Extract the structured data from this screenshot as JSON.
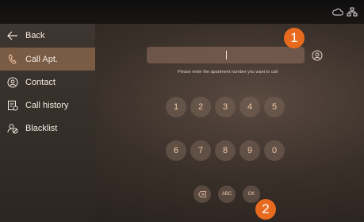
{
  "sidebar": {
    "items": [
      {
        "label": "Back",
        "icon": "arrow-left-icon"
      },
      {
        "label": "Call Apt.",
        "icon": "phone-icon"
      },
      {
        "label": "Contact",
        "icon": "contact-icon"
      },
      {
        "label": "Call history",
        "icon": "call-history-icon"
      },
      {
        "label": "Blacklist",
        "icon": "blacklist-icon"
      }
    ]
  },
  "dialer": {
    "input_value": "",
    "hint": "Please enter the apartment number you want to call",
    "keys_row1": [
      "1",
      "2",
      "3",
      "4",
      "5"
    ],
    "keys_row2": [
      "6",
      "7",
      "8",
      "9",
      "0"
    ],
    "abc_label": "ABC",
    "ok_label": "OK"
  },
  "badges": {
    "one": "1",
    "two": "2"
  },
  "colors": {
    "accent": "#e86a1e",
    "active_item": "#7a5b43",
    "key_text": "#f0c9a8"
  }
}
